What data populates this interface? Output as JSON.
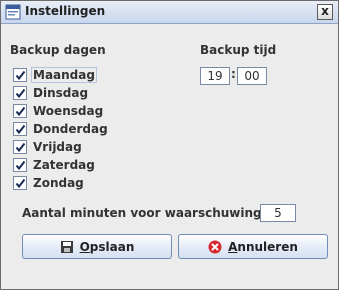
{
  "window": {
    "title": "Instellingen",
    "close_label": "x"
  },
  "backup_days": {
    "label": "Backup dagen",
    "days": [
      {
        "label": "Maandag",
        "checked": true
      },
      {
        "label": "Dinsdag",
        "checked": true
      },
      {
        "label": "Woensdag",
        "checked": true
      },
      {
        "label": "Donderdag",
        "checked": true
      },
      {
        "label": "Vrijdag",
        "checked": true
      },
      {
        "label": "Zaterdag",
        "checked": true
      },
      {
        "label": "Zondag",
        "checked": true
      }
    ]
  },
  "backup_time": {
    "label": "Backup tijd",
    "hour": "19",
    "separator": ":",
    "minute": "00"
  },
  "warning": {
    "label": "Aantal minuten voor waarschuwing",
    "value": "5"
  },
  "buttons": {
    "save": {
      "first": "O",
      "rest": "pslaan",
      "icon": "floppy-disk-icon"
    },
    "cancel": {
      "first": "A",
      "rest": "nnuleren",
      "icon": "cancel-icon"
    }
  },
  "colors": {
    "title_gradient_top": "#e9eef8",
    "title_gradient_bottom": "#c8d6ee",
    "check": "#1a2a55"
  }
}
